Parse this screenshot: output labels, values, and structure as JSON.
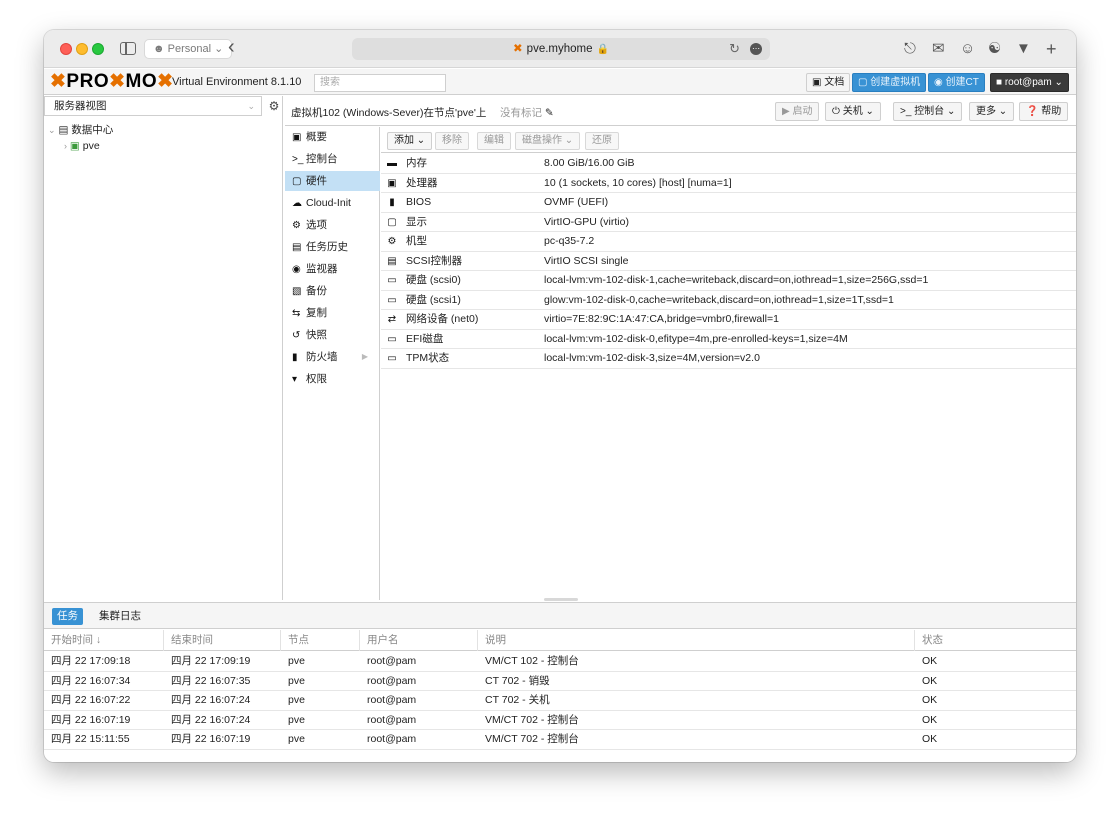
{
  "browser": {
    "profile": "Personal",
    "url": "pve.myhome"
  },
  "header": {
    "logo_left": "PRO",
    "logo_mid": "MO",
    "version": "Virtual Environment 8.1.10",
    "search_placeholder": "搜索",
    "docs": "文档",
    "create_vm": "创建虚拟机",
    "create_ct": "创建CT",
    "user": "root@pam"
  },
  "tree": {
    "view": "服务器视图",
    "datacenter": "数据中心",
    "node": "pve"
  },
  "toolbar": {
    "vm_title": "虚拟机102 (Windows-Sever)在节点'pve'上",
    "tags": "没有标记",
    "start": "启动",
    "shutdown": "关机",
    "console": "控制台",
    "more": "更多",
    "help": "帮助"
  },
  "nav": {
    "items": [
      {
        "label": "概要",
        "icon": "book-icon"
      },
      {
        "label": "控制台",
        "icon": "terminal-icon"
      },
      {
        "label": "硬件",
        "icon": "monitor-icon"
      },
      {
        "label": "Cloud-Init",
        "icon": "cloud-icon"
      },
      {
        "label": "选项",
        "icon": "gear-icon"
      },
      {
        "label": "任务历史",
        "icon": "list-icon"
      },
      {
        "label": "监视器",
        "icon": "eye-icon"
      },
      {
        "label": "备份",
        "icon": "floppy-icon"
      },
      {
        "label": "复制",
        "icon": "retweet-icon"
      },
      {
        "label": "快照",
        "icon": "history-icon"
      },
      {
        "label": "防火墙",
        "icon": "shield-icon"
      },
      {
        "label": "权限",
        "icon": "unlock-icon"
      }
    ]
  },
  "hw_toolbar": {
    "add": "添加",
    "remove": "移除",
    "edit": "编辑",
    "disk_action": "磁盘操作",
    "revert": "还原"
  },
  "hardware": [
    {
      "icon": "memory-icon",
      "key": "内存",
      "value": "8.00 GiB/16.00 GiB"
    },
    {
      "icon": "cpu-icon",
      "key": "处理器",
      "value": "10 (1 sockets, 10 cores) [host] [numa=1]"
    },
    {
      "icon": "bios-icon",
      "key": "BIOS",
      "value": "OVMF (UEFI)"
    },
    {
      "icon": "display-icon",
      "key": "显示",
      "value": "VirtIO-GPU (virtio)"
    },
    {
      "icon": "cogs-icon",
      "key": "机型",
      "value": "pc-q35-7.2"
    },
    {
      "icon": "database-icon",
      "key": "SCSI控制器",
      "value": "VirtIO SCSI single"
    },
    {
      "icon": "hdd-icon",
      "key": "硬盘 (scsi0)",
      "value": "local-lvm:vm-102-disk-1,cache=writeback,discard=on,iothread=1,size=256G,ssd=1"
    },
    {
      "icon": "hdd-icon",
      "key": "硬盘 (scsi1)",
      "value": "glow:vm-102-disk-0,cache=writeback,discard=on,iothread=1,size=1T,ssd=1"
    },
    {
      "icon": "exchange-icon",
      "key": "网络设备 (net0)",
      "value": "virtio=7E:82:9C:1A:47:CA,bridge=vmbr0,firewall=1"
    },
    {
      "icon": "hdd-icon",
      "key": "EFI磁盘",
      "value": "local-lvm:vm-102-disk-0,efitype=4m,pre-enrolled-keys=1,size=4M"
    },
    {
      "icon": "hdd-icon",
      "key": "TPM状态",
      "value": "local-lvm:vm-102-disk-3,size=4M,version=v2.0"
    }
  ],
  "log": {
    "tabs": [
      "任务",
      "集群日志"
    ],
    "columns": [
      "开始时间",
      "结束时间",
      "节点",
      "用户名",
      "说明",
      "状态"
    ],
    "rows": [
      [
        "四月 22 17:09:18",
        "四月 22 17:09:19",
        "pve",
        "root@pam",
        "VM/CT 102 - 控制台",
        "OK"
      ],
      [
        "四月 22 16:07:34",
        "四月 22 16:07:35",
        "pve",
        "root@pam",
        "CT 702 - 销毁",
        "OK"
      ],
      [
        "四月 22 16:07:22",
        "四月 22 16:07:24",
        "pve",
        "root@pam",
        "CT 702 - 关机",
        "OK"
      ],
      [
        "四月 22 16:07:19",
        "四月 22 16:07:24",
        "pve",
        "root@pam",
        "VM/CT 702 - 控制台",
        "OK"
      ],
      [
        "四月 22 15:11:55",
        "四月 22 16:07:19",
        "pve",
        "root@pam",
        "VM/CT 702 - 控制台",
        "OK"
      ]
    ]
  },
  "colors": {
    "accent": "#3892d4",
    "brand": "#e57000",
    "selection": "#c3e0f5"
  }
}
